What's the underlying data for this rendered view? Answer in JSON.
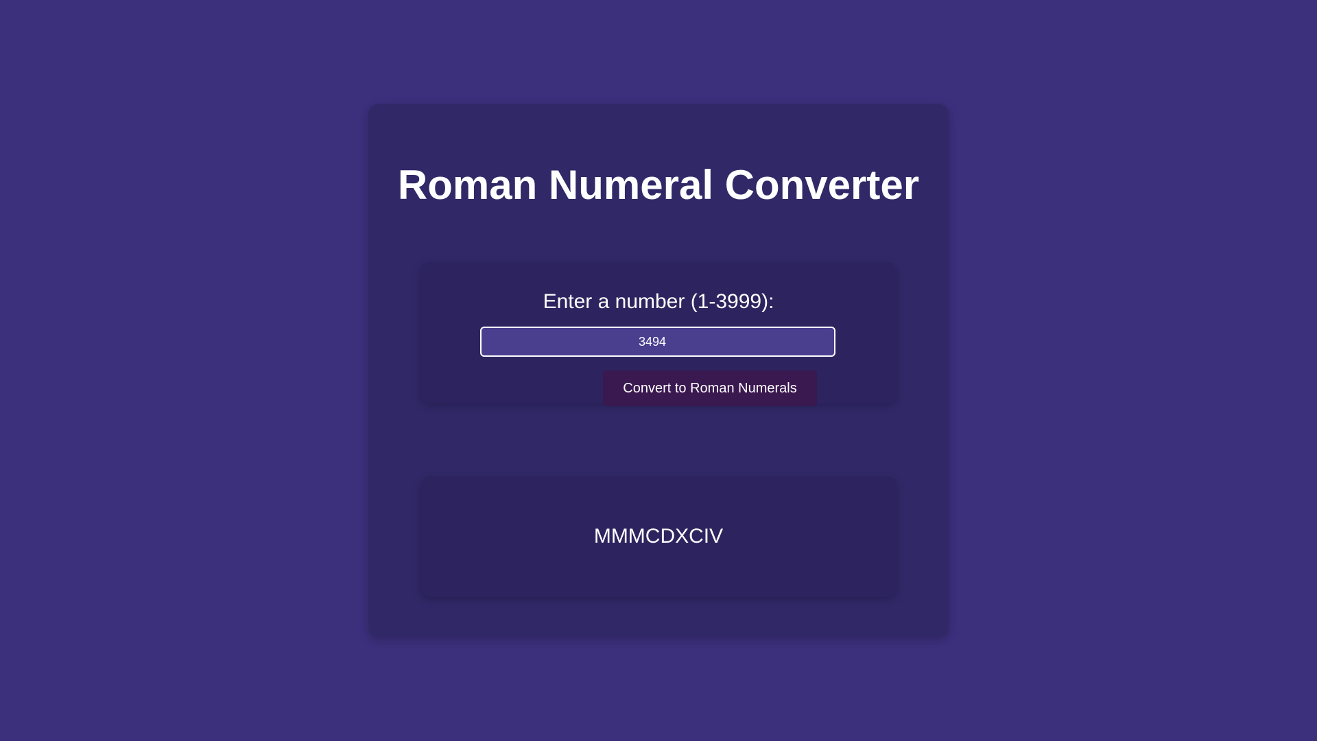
{
  "app": {
    "title": "Roman Numeral Converter"
  },
  "form": {
    "label": "Enter a number (1-3999):",
    "input_value": "3494",
    "button_label": "Convert to Roman Numerals"
  },
  "result": {
    "output": "MMMCDXCIV"
  },
  "colors": {
    "background": "#3c2f7c",
    "container": "#312868",
    "panel": "#2d245f",
    "input_background": "#4a3e8e",
    "button_background": "#3a1850",
    "text": "#ffffff"
  }
}
